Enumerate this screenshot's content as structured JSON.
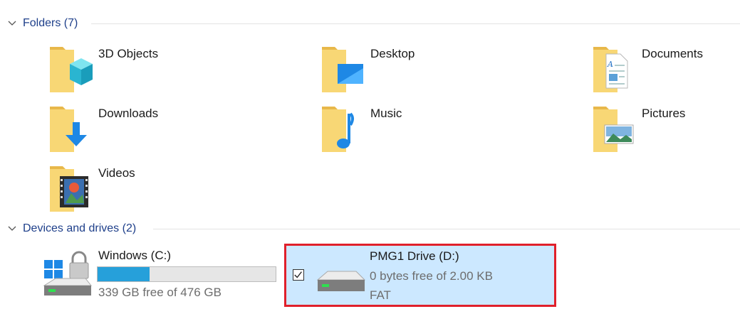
{
  "folders_group": {
    "title": "Folders (7)"
  },
  "folders": [
    {
      "label": "3D Objects",
      "icon": "3d-objects-folder-icon"
    },
    {
      "label": "Desktop",
      "icon": "desktop-folder-icon"
    },
    {
      "label": "Documents",
      "icon": "documents-folder-icon"
    },
    {
      "label": "Downloads",
      "icon": "downloads-folder-icon"
    },
    {
      "label": "Music",
      "icon": "music-folder-icon"
    },
    {
      "label": "Pictures",
      "icon": "pictures-folder-icon"
    },
    {
      "label": "Videos",
      "icon": "videos-folder-icon"
    }
  ],
  "devices_group": {
    "title": "Devices and drives (2)"
  },
  "drives": [
    {
      "name": "Windows (C:)",
      "free_text": "339 GB free of 476 GB",
      "used_fraction": 0.29,
      "icon": "windows-drive-icon"
    },
    {
      "name": "PMG1 Drive (D:)",
      "free_text": "0 bytes free of 2.00 KB",
      "filesystem": "FAT",
      "icon": "removable-drive-icon",
      "selected": true,
      "checked": true
    }
  ],
  "colors": {
    "accent": "#26a0da",
    "selection_bg": "#cce8ff",
    "highlight_border": "#e0202b",
    "group_title": "#1e3f8a"
  }
}
